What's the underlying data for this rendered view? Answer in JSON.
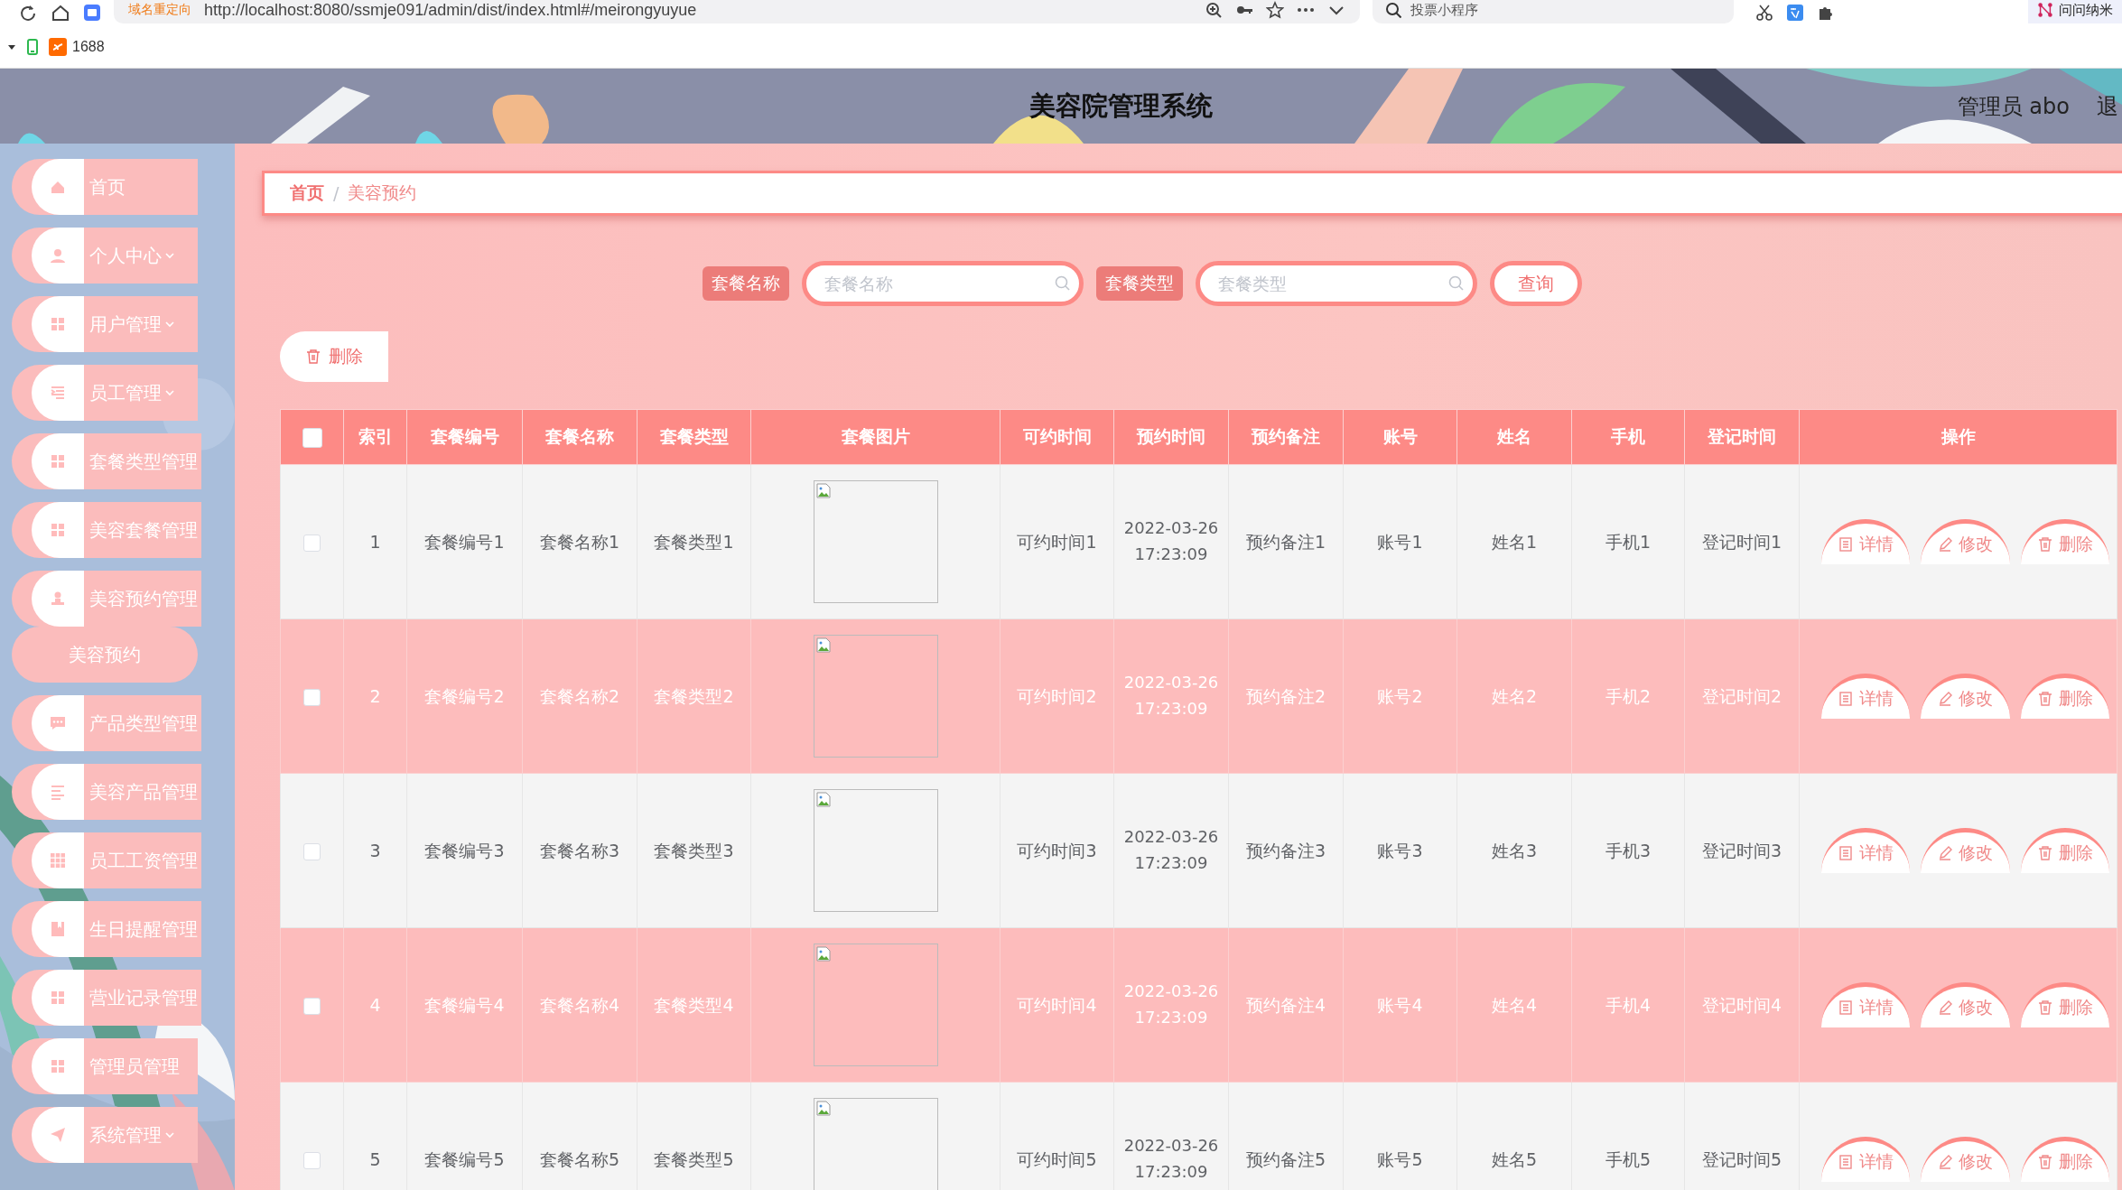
{
  "browser": {
    "notice": "域名重定向",
    "url": "http://localhost:8080/ssmje091/admin/dist/index.html#/meirongyuyue",
    "search_placeholder": "投票小程序",
    "extension": "问问纳米",
    "bookmarks": [
      {
        "label": "1688"
      }
    ]
  },
  "header": {
    "title": "美容院管理系统",
    "user": "管理员 abo",
    "logout": "退"
  },
  "sidebar": {
    "items": [
      {
        "label": "首页",
        "expandable": false,
        "selected": false
      },
      {
        "label": "个人中心",
        "expandable": true,
        "selected": false
      },
      {
        "label": "用户管理",
        "expandable": true,
        "selected": false
      },
      {
        "label": "员工管理",
        "expandable": true,
        "selected": false
      },
      {
        "label": "套餐类型管理",
        "expandable": false,
        "selected": false
      },
      {
        "label": "美容套餐管理",
        "expandable": false,
        "selected": false
      },
      {
        "label": "美容预约管理",
        "expandable": false,
        "selected": false,
        "children": [
          {
            "label": "美容预约",
            "selected": true
          }
        ]
      },
      {
        "label": "产品类型管理",
        "expandable": false,
        "selected": false
      },
      {
        "label": "美容产品管理",
        "expandable": false,
        "selected": false
      },
      {
        "label": "员工工资管理",
        "expandable": false,
        "selected": false
      },
      {
        "label": "生日提醒管理",
        "expandable": false,
        "selected": false
      },
      {
        "label": "营业记录管理",
        "expandable": false,
        "selected": false
      },
      {
        "label": "管理员管理",
        "expandable": false,
        "selected": false
      },
      {
        "label": "系统管理",
        "expandable": true,
        "selected": false
      }
    ]
  },
  "breadcrumb": {
    "items": [
      "首页",
      "美容预约"
    ],
    "separator": "/"
  },
  "search": {
    "fields": [
      {
        "label": "套餐名称",
        "placeholder": "套餐名称"
      },
      {
        "label": "套餐类型",
        "placeholder": "套餐类型"
      }
    ],
    "button": "查询"
  },
  "toolbar": {
    "delete": "删除"
  },
  "table": {
    "select_all_checked": false,
    "columns": [
      "索引",
      "套餐编号",
      "套餐名称",
      "套餐类型",
      "套餐图片",
      "可约时间",
      "预约时间",
      "预约备注",
      "账号",
      "姓名",
      "手机",
      "登记时间",
      "操作"
    ],
    "rows": [
      {
        "checked": false,
        "cells": [
          "1",
          "套餐编号1",
          "套餐名称1",
          "套餐类型1",
          {
            "kind": "picture"
          },
          "可约时间1",
          "2022-03-26 17:23:09",
          "预约备注1",
          "账号1",
          "姓名1",
          "手机1",
          "登记时间1",
          {
            "kind": "actions",
            "actions": [
              "详情",
              "修改",
              "删除"
            ]
          }
        ]
      },
      {
        "checked": false,
        "cells": [
          "2",
          "套餐编号2",
          "套餐名称2",
          "套餐类型2",
          {
            "kind": "picture"
          },
          "可约时间2",
          "2022-03-26 17:23:09",
          "预约备注2",
          "账号2",
          "姓名2",
          "手机2",
          "登记时间2",
          {
            "kind": "actions",
            "actions": [
              "详情",
              "修改",
              "删除"
            ]
          }
        ]
      },
      {
        "checked": false,
        "cells": [
          "3",
          "套餐编号3",
          "套餐名称3",
          "套餐类型3",
          {
            "kind": "picture"
          },
          "可约时间3",
          "2022-03-26 17:23:09",
          "预约备注3",
          "账号3",
          "姓名3",
          "手机3",
          "登记时间3",
          {
            "kind": "actions",
            "actions": [
              "详情",
              "修改",
              "删除"
            ]
          }
        ]
      },
      {
        "checked": false,
        "cells": [
          "4",
          "套餐编号4",
          "套餐名称4",
          "套餐类型4",
          {
            "kind": "picture"
          },
          "可约时间4",
          "2022-03-26 17:23:09",
          "预约备注4",
          "账号4",
          "姓名4",
          "手机4",
          "登记时间4",
          {
            "kind": "actions",
            "actions": [
              "详情",
              "修改",
              "删除"
            ]
          }
        ]
      },
      {
        "checked": false,
        "cells": [
          "5",
          "套餐编号5",
          "套餐名称5",
          "套餐类型5",
          {
            "kind": "picture"
          },
          "可约时间5",
          "2022-03-26 17:23:09",
          "预约备注5",
          "账号5",
          "姓名5",
          "手机5",
          "登记时间5",
          {
            "kind": "actions",
            "actions": [
              "详情",
              "修改",
              "删除"
            ]
          }
        ]
      }
    ]
  }
}
